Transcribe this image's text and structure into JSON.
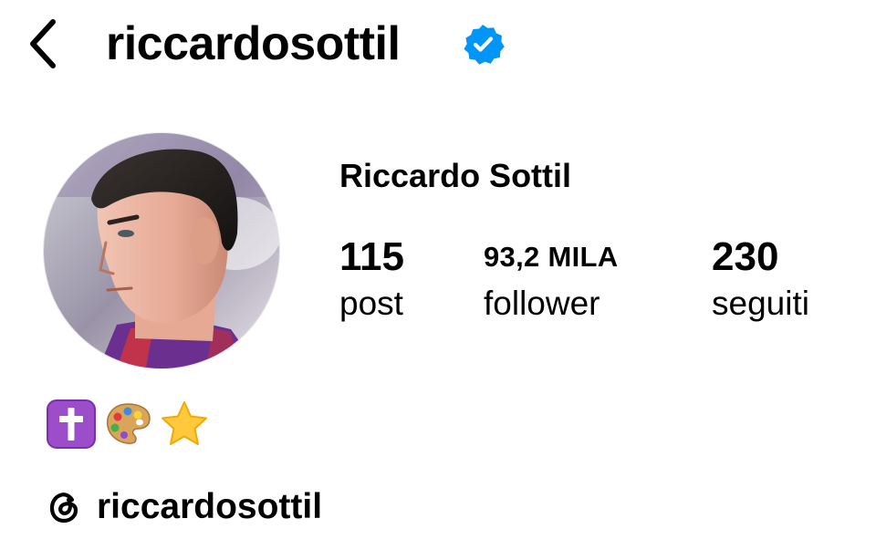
{
  "header": {
    "username": "riccardosottil",
    "verified": true,
    "back_icon": "chevron-left-icon"
  },
  "profile": {
    "full_name": "Riccardo Sottil",
    "avatar_icon": "profile-photo"
  },
  "stats": {
    "posts": {
      "value": "115",
      "label": "post"
    },
    "followers": {
      "value": "93,2 MILA",
      "label": "follower"
    },
    "following": {
      "value": "230",
      "label": "seguiti"
    }
  },
  "bio": {
    "emojis": [
      "latin-cross-emoji",
      "artist-palette-emoji",
      "star-emoji"
    ]
  },
  "threads": {
    "icon": "threads-icon",
    "handle": "riccardosottil"
  },
  "colors": {
    "text": "#000000",
    "verified_blue": "#0095F6",
    "cross_purple": "#8E44AD",
    "star_yellow": "#FFC83D"
  }
}
